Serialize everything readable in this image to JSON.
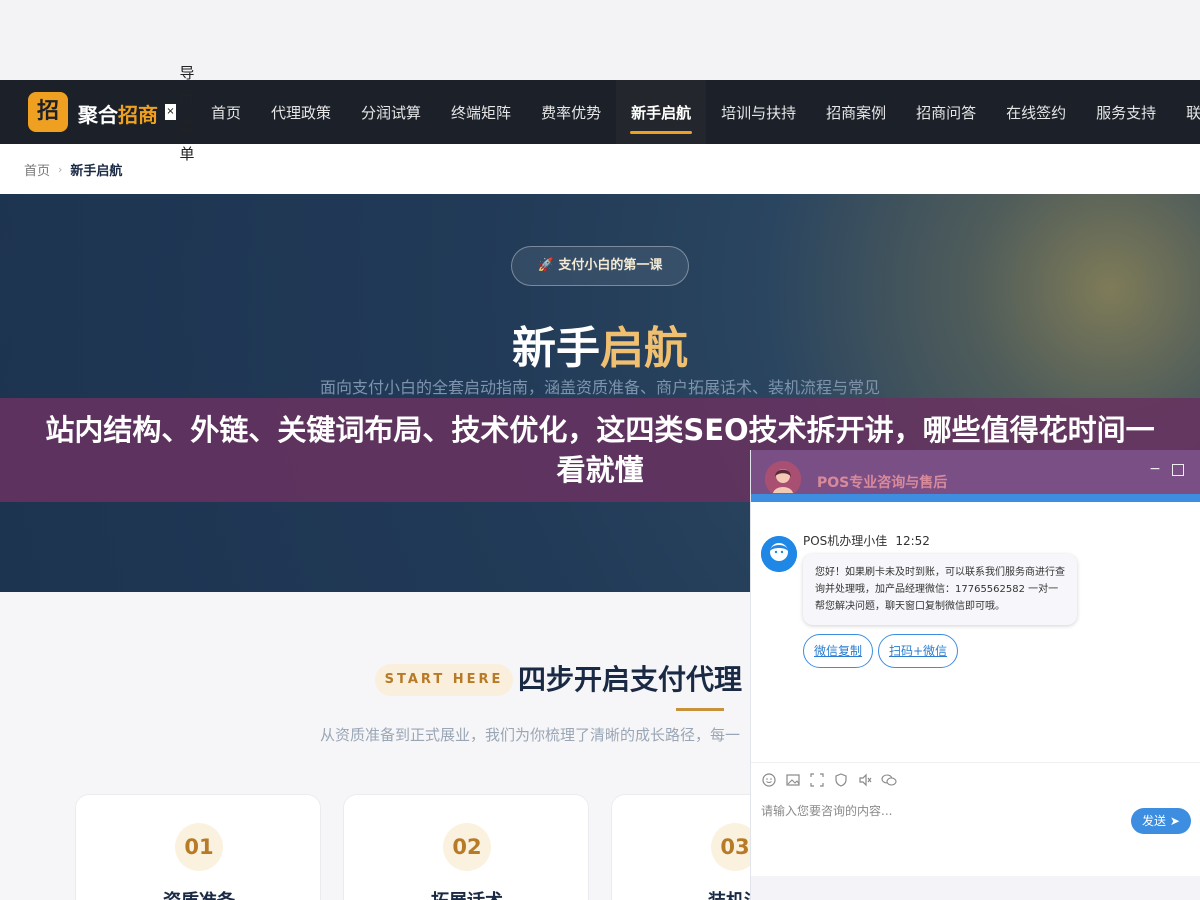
{
  "navbar": {
    "logo_char": "招",
    "brand_main": "聚合",
    "brand_accent": "招商",
    "close_label": "×",
    "menu_label": "导航菜单",
    "items": [
      {
        "label": "首页"
      },
      {
        "label": "代理政策"
      },
      {
        "label": "分润试算"
      },
      {
        "label": "终端矩阵"
      },
      {
        "label": "费率优势"
      },
      {
        "label": "新手启航",
        "active": true
      },
      {
        "label": "培训与扶持"
      },
      {
        "label": "招商案例"
      },
      {
        "label": "招商问答"
      },
      {
        "label": "在线签约"
      },
      {
        "label": "服务支持"
      },
      {
        "label": "联系"
      }
    ]
  },
  "breadcrumb": {
    "home": "首页",
    "separator": "›",
    "current": "新手启航"
  },
  "hero": {
    "badge": "🚀 支付小白的第一课",
    "title_main": "新手",
    "title_accent": "启航",
    "subtitle": "面向支付小白的全套启动指南，涵盖资质准备、商户拓展话术、装机流程与常见"
  },
  "banner": {
    "text": "站内结构、外链、关键词布局、技术优化，这四类SEO技术拆开讲，哪些值得花时间一看就懂"
  },
  "section": {
    "pill": "START HERE",
    "title": "四步开启支付代理",
    "subtitle": "从资质准备到正式展业，我们为你梳理了清晰的成长路径，每一",
    "steps": [
      {
        "num": "01",
        "title": "资质准备"
      },
      {
        "num": "02",
        "title": "拓展话术"
      },
      {
        "num": "03",
        "title": "装机流"
      }
    ]
  },
  "chat": {
    "title": "POS专业咨询与售后",
    "min_icon": "−",
    "agent_name": "POS机办理小佳",
    "time": "12:52",
    "message": "您好！如果刷卡未及时到账，可以联系我们服务商进行查询并处理哦，加产品经理微信：17765562582 一对一帮您解决问题，聊天窗口复制微信即可哦。",
    "quick_buttons": [
      "微信复制",
      "扫码+微信"
    ],
    "toolbar_icons": [
      "emoji-icon",
      "image-icon",
      "screenshot-icon",
      "shield-icon",
      "mute-icon",
      "wechat-icon"
    ],
    "input_placeholder": "请输入您要咨询的内容...",
    "send_label": "发送",
    "send_arrow": "➤"
  },
  "colors": {
    "nav_bg": "#1b2029",
    "accent": "#f0a020",
    "hero_bg": "#213a57",
    "banner_bg": "#663260",
    "chat_header": "#7a4f86",
    "chat_blue": "#3d8ee0"
  }
}
